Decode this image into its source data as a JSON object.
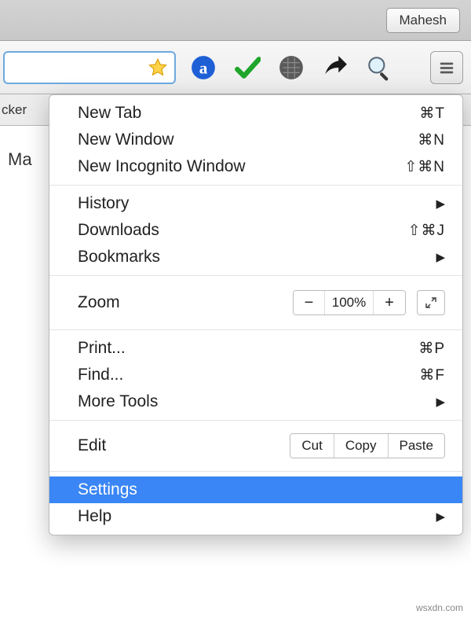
{
  "titlebar": {
    "user_label": "Mahesh"
  },
  "tabstrip": {
    "partial_tab_text": "cker"
  },
  "content": {
    "partial_text": "Ma"
  },
  "menu": {
    "group1": {
      "new_tab": {
        "label": "New Tab",
        "shortcut": "⌘T"
      },
      "new_window": {
        "label": "New Window",
        "shortcut": "⌘N"
      },
      "new_incognito": {
        "label": "New Incognito Window",
        "shortcut": "⇧⌘N"
      }
    },
    "group2": {
      "history": {
        "label": "History"
      },
      "downloads": {
        "label": "Downloads",
        "shortcut": "⇧⌘J"
      },
      "bookmarks": {
        "label": "Bookmarks"
      }
    },
    "zoom": {
      "label": "Zoom",
      "value": "100%"
    },
    "group4": {
      "print": {
        "label": "Print...",
        "shortcut": "⌘P"
      },
      "find": {
        "label": "Find...",
        "shortcut": "⌘F"
      },
      "more_tools": {
        "label": "More Tools"
      }
    },
    "edit": {
      "label": "Edit",
      "cut": "Cut",
      "copy": "Copy",
      "paste": "Paste"
    },
    "group6": {
      "settings": {
        "label": "Settings"
      },
      "help": {
        "label": "Help"
      }
    }
  },
  "watermark": "wsxdn.com"
}
